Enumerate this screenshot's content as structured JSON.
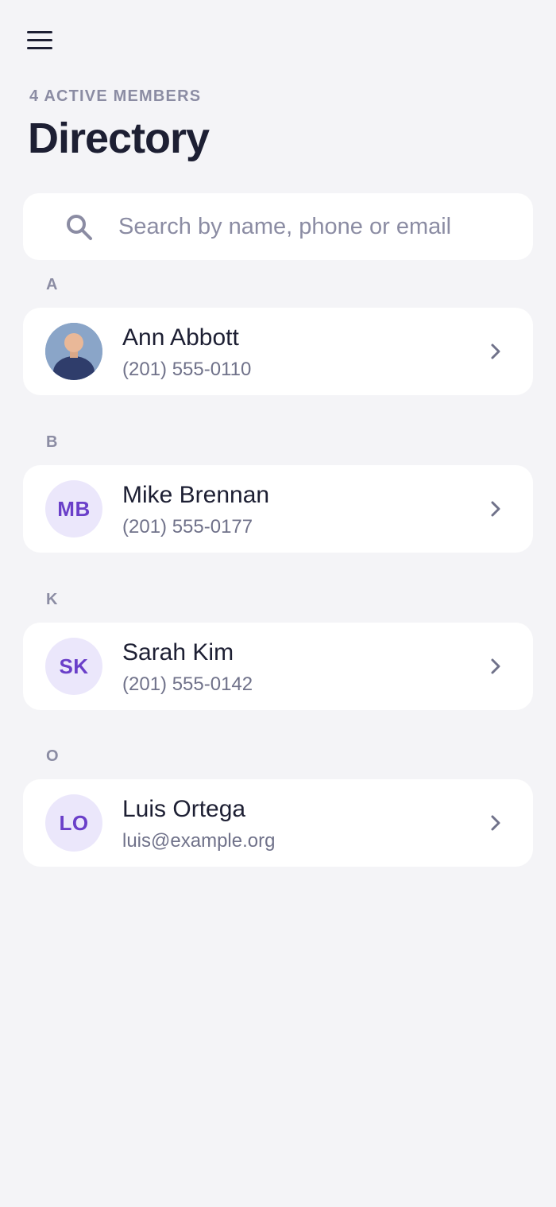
{
  "header": {
    "menu_icon": "hamburger-menu-icon",
    "eyebrow": "4 ACTIVE MEMBERS",
    "title": "Directory"
  },
  "search": {
    "icon": "search-icon",
    "placeholder": "Search by name, phone or email",
    "value": ""
  },
  "sections": [
    {
      "letter": "A",
      "members": [
        {
          "name": "Ann Abbott",
          "detail": "(201) 555-0110",
          "avatar_type": "photo",
          "initials": ""
        }
      ]
    },
    {
      "letter": "B",
      "members": [
        {
          "name": "Mike Brennan",
          "detail": "(201) 555-0177",
          "avatar_type": "initials",
          "initials": "MB"
        }
      ]
    },
    {
      "letter": "K",
      "members": [
        {
          "name": "Sarah Kim",
          "detail": "(201) 555-0142",
          "avatar_type": "initials",
          "initials": "SK"
        }
      ]
    },
    {
      "letter": "O",
      "members": [
        {
          "name": "Luis Ortega",
          "detail": "luis@example.org",
          "avatar_type": "initials",
          "initials": "LO"
        }
      ]
    }
  ],
  "colors": {
    "background": "#f4f4f7",
    "card": "#ffffff",
    "title_text": "#1d1f33",
    "muted_text": "#8b8ca3",
    "avatar_bg": "#ebe7fb",
    "avatar_text": "#6a3fc9"
  }
}
